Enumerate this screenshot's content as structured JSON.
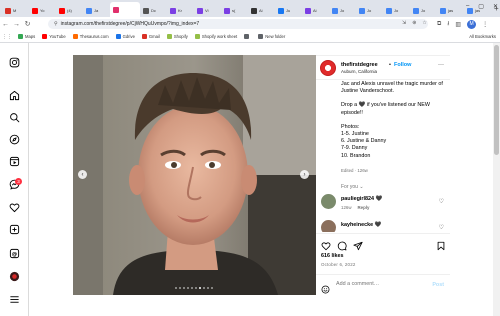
{
  "browser": {
    "tabs": [
      {
        "label": "M",
        "color": "#d93025"
      },
      {
        "label": "Yo",
        "color": "#ff0000"
      },
      {
        "label": "(4)",
        "color": "#ff0000"
      },
      {
        "label": "Ja",
        "color": "#4285f4"
      },
      {
        "label": "",
        "color": "#e1306c",
        "active": true
      },
      {
        "label": "Dc",
        "color": "#555555"
      },
      {
        "label": "Kr",
        "color": "#7b3fe4"
      },
      {
        "label": "Vi",
        "color": "#7b3fe4"
      },
      {
        "label": "s(",
        "color": "#7b3fe4"
      },
      {
        "label": "Ai",
        "color": "#333333"
      },
      {
        "label": "Ju",
        "color": "#1877f2"
      },
      {
        "label": "Ai",
        "color": "#7b3fe4"
      },
      {
        "label": "Jo",
        "color": "#4285f4"
      },
      {
        "label": "Jo",
        "color": "#4285f4"
      },
      {
        "label": "Jo",
        "color": "#4285f4"
      },
      {
        "label": "Jo",
        "color": "#4285f4"
      },
      {
        "label": "jas",
        "color": "#4285f4"
      },
      {
        "label": "jas",
        "color": "#4285f4"
      }
    ],
    "url": "instagram.com/thefirstdegree/p/CjWHQuUvmpo/?img_index=7",
    "profile_initial": "M",
    "bookmarks": [
      {
        "label": "Maps",
        "color": "#34a853"
      },
      {
        "label": "YouTube",
        "color": "#ff0000"
      },
      {
        "label": "Thesaurus.com",
        "color": "#ff6a00"
      },
      {
        "label": "Gdrive",
        "color": "#1a73e8"
      },
      {
        "label": "Gmail",
        "color": "#d93025"
      },
      {
        "label": "Shopify",
        "color": "#95bf47"
      },
      {
        "label": "Shopify work sheet",
        "color": "#95bf47"
      },
      {
        "label": "",
        "color": "#5f6368"
      },
      {
        "label": "New folder",
        "color": "#5f6368"
      }
    ],
    "all_bookmarks": "All Bookmarks"
  },
  "rail": {
    "notification_count": "3"
  },
  "post": {
    "username": "thefirstdegree",
    "separator": "•",
    "follow_label": "Follow",
    "location": "Auburn, California",
    "caption_paragraphs": [
      "Jac and Alexis unravel the tragic murder of Justine Vanderschoot.",
      "Drop a 🖤 if you've listened our NEW episode!!",
      "Photos:\n1-5. Justine\n6. Justine & Danny\n7-9. Danny\n10. Brandon"
    ],
    "edited": "Edited · 126w",
    "for_you": "For you ⌄",
    "carousel": {
      "total": 10,
      "current": 7
    },
    "comments": [
      {
        "username": "pauliegirl824 🖤",
        "age": "126w",
        "reply": "Reply",
        "avatar_color": "#7a8a6b"
      },
      {
        "username": "kayheinecke 🖤",
        "age": "",
        "reply": "",
        "avatar_color": "#8b6f5c"
      }
    ],
    "likes": "616 likes",
    "date": "October 6, 2022",
    "comment_placeholder": "Add a comment…",
    "post_button": "Post"
  }
}
